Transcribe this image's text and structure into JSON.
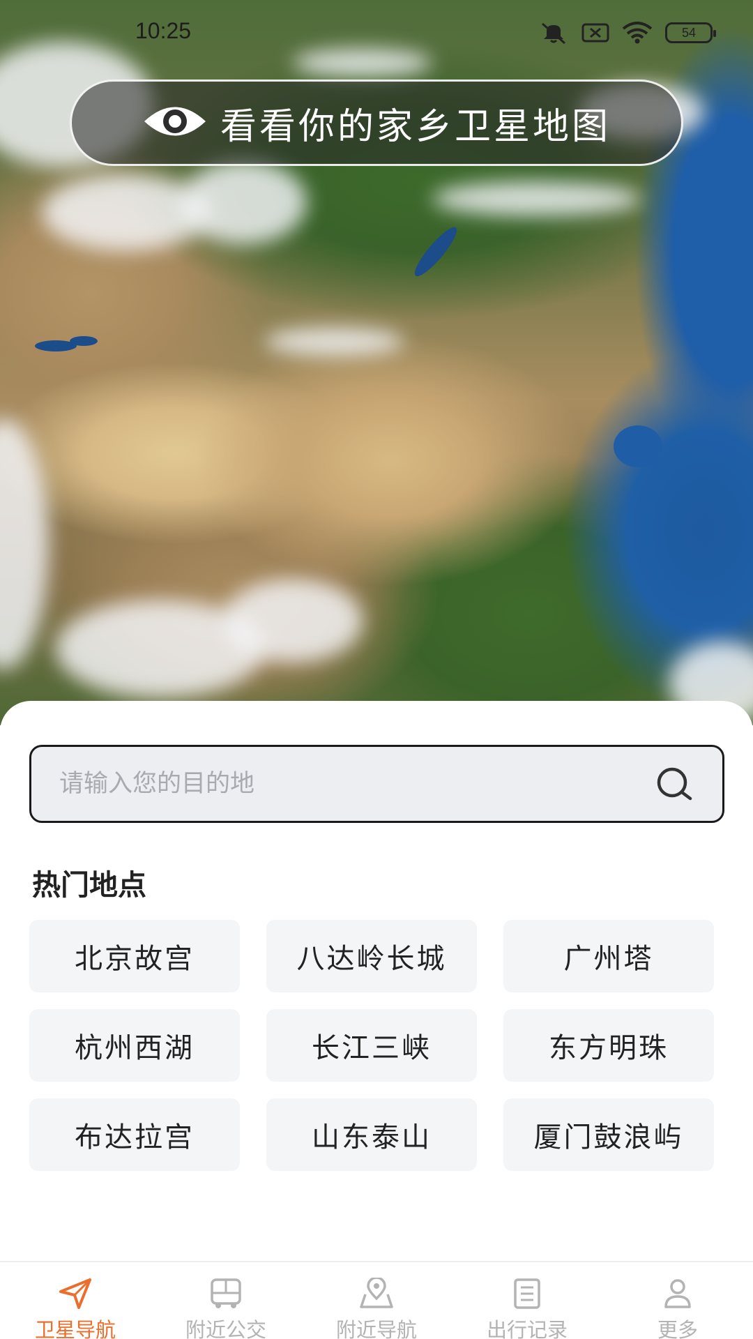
{
  "status_bar": {
    "time": "10:25",
    "battery": "54",
    "icons": [
      "mute-icon",
      "notification-icon",
      "wifi-icon",
      "battery-icon"
    ]
  },
  "banner": {
    "text": "看看你的家乡卫星地图",
    "icon": "eye-icon"
  },
  "search": {
    "placeholder": "请输入您的目的地",
    "icon": "search-icon"
  },
  "hot_places": {
    "title": "热门地点",
    "items": [
      "北京故宫",
      "八达岭长城",
      "广州塔",
      "杭州西湖",
      "长江三峡",
      "东方明珠",
      "布达拉宫",
      "山东泰山",
      "厦门鼓浪屿"
    ]
  },
  "bottom_nav": {
    "active_color": "#ec6d2c",
    "inactive_color": "#b3b3b3",
    "items": [
      {
        "label": "卫星导航",
        "icon": "navigation-arrow-icon",
        "active": true
      },
      {
        "label": "附近公交",
        "icon": "bus-icon",
        "active": false
      },
      {
        "label": "附近导航",
        "icon": "map-pin-icon",
        "active": false
      },
      {
        "label": "出行记录",
        "icon": "list-icon",
        "active": false
      },
      {
        "label": "更多",
        "icon": "user-icon",
        "active": false
      }
    ]
  }
}
